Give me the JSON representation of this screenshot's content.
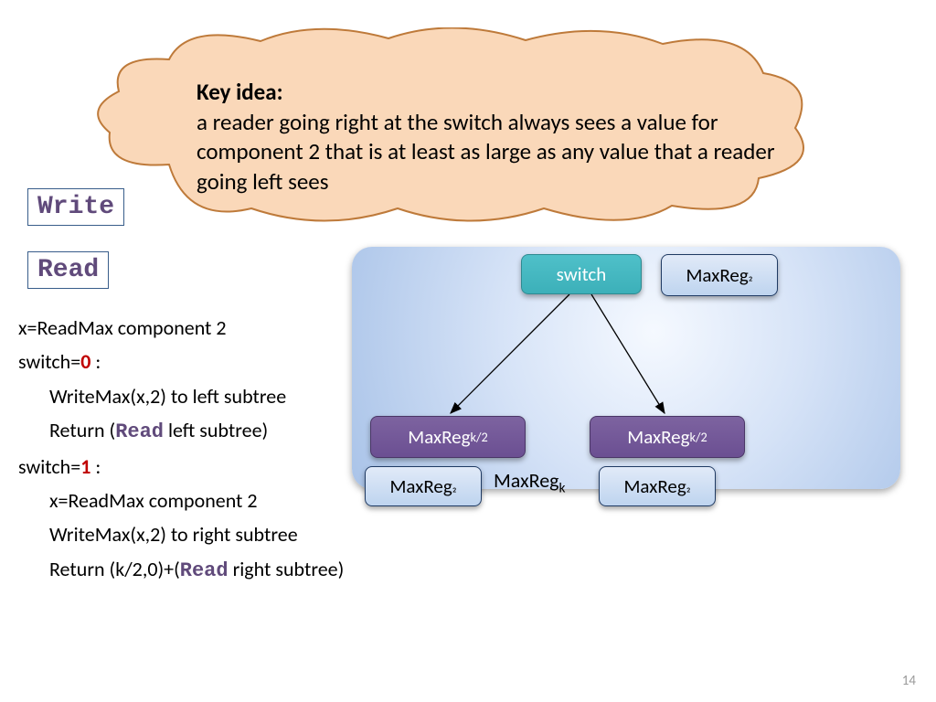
{
  "cloud": {
    "heading": "Key idea",
    "body": "a reader going right at the switch always sees a value for component 2 that is at least as large as any value that a reader going left sees"
  },
  "labels": {
    "write": "Write",
    "read": "Read"
  },
  "pseudo": {
    "l1": "x=ReadMax component 2",
    "l2a": "switch=",
    "l2b": "0",
    "l2c": " :",
    "l3": "WriteMax(x,2) to left subtree",
    "l4a": "Return (",
    "l4b": "Read",
    "l4c": "  left subtree)",
    "l5a": "switch=",
    "l5b": "1",
    "l5c": " :",
    "l6": "x=ReadMax component 2",
    "l7": "WriteMax(x,2) to right subtree",
    "l8a": "Return (k/2,0)+(",
    "l8b": "Read",
    "l8c": "  right subtree)"
  },
  "diagram": {
    "switch": "switch",
    "maxreg_top": "MaxReg",
    "maxreg_top_sub": "₂",
    "purple_l": "MaxReg",
    "purple_l_sub": "k/2",
    "purple_r": "MaxReg",
    "purple_r_sub": "k/2",
    "maxreg_bl": "MaxReg",
    "maxreg_bl_sub": "₂",
    "maxreg_br": "MaxReg",
    "maxreg_br_sub": "₂",
    "center_label": "MaxReg",
    "center_label_sub": "k"
  },
  "page": "14"
}
